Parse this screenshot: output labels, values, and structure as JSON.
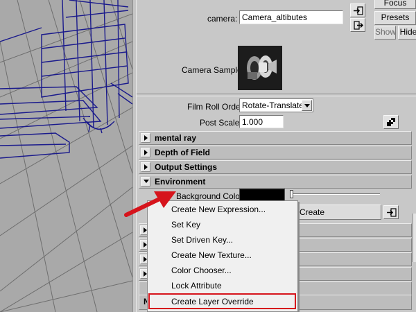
{
  "top_panel": {
    "focus_label": "Focus",
    "camera_label": "camera:",
    "camera_value": "Camera_altibutes",
    "presets_label": "Presets",
    "show_label": "Show",
    "hide_label": "Hide",
    "camera_sample_label": "Camera Sample"
  },
  "film_roll": {
    "label": "Film Roll Order",
    "value": "Rotate-Translate"
  },
  "post_scale": {
    "label": "Post Scale",
    "value": "1.000"
  },
  "sections": [
    {
      "label": "mental ray",
      "expanded": false
    },
    {
      "label": "Depth of Field",
      "expanded": false
    },
    {
      "label": "Output Settings",
      "expanded": false
    },
    {
      "label": "Environment",
      "expanded": true
    }
  ],
  "environment": {
    "background_color_label": "Background Color",
    "background_color": "#000000",
    "image_plane_create_label": "Create"
  },
  "context_menu": {
    "items": [
      "Create New Expression...",
      "Set Key",
      "Set Driven Key...",
      "Create New Texture...",
      "Color Chooser...",
      "Lock Attribute",
      "Create Layer Override"
    ],
    "highlighted_item": "Create Layer Override"
  },
  "partial_label": "N",
  "colors": {
    "annotation_red": "#d6141c",
    "wireframe_blue": "#1a1a8c",
    "panel_gray": "#c8c8c8"
  },
  "icons": {
    "camera_select": "arrow-into-box-icon",
    "camera_create": "arrow-right-box-icon",
    "post_scale_map": "checker-icon",
    "image_plane_map": "arrow-into-box-icon",
    "section_toggle": "triangle-right-icon",
    "environment_toggle": "triangle-down-icon"
  }
}
